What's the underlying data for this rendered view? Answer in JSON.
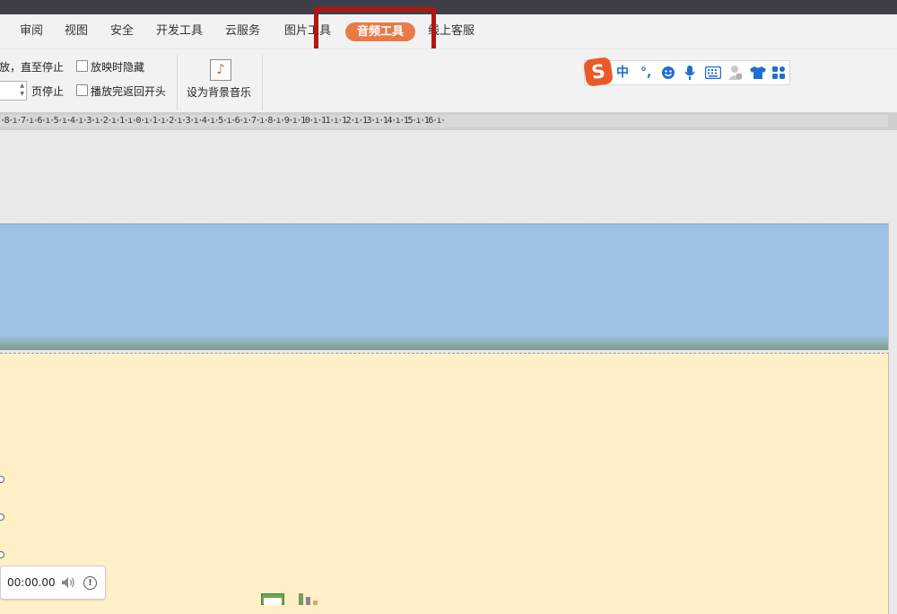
{
  "menu": {
    "tabs": [
      {
        "label": "审阅"
      },
      {
        "label": "视图"
      },
      {
        "label": "安全"
      },
      {
        "label": "开发工具"
      },
      {
        "label": "云服务"
      },
      {
        "label": "图片工具"
      },
      {
        "label": "音频工具",
        "active": true
      },
      {
        "label": "线上客服"
      }
    ]
  },
  "ribbon": {
    "play_until_stop_label": "放，直至停止",
    "page_stop_label": "页停止",
    "hide_when_showing_label": "放映时隐藏",
    "rewind_after_play_label": "播放完返回开头",
    "set_background_music_label": "设为背景音乐"
  },
  "ime_toolbar": {
    "logo": "S",
    "mode": "中",
    "punctuation": "°,"
  },
  "ruler": {
    "text": "·8·ı·7·ı·6·ı·5·ı·4·ı·3·ı·2·ı·1·ı·0·ı·1·ı·2·ı·3·ı·4·ı·5·ı·6·ı·7·ı·8·ı·9·ı·10·ı·11·ı·12·ı·13·ı·14·ı·15·ı·16·ı·"
  },
  "player": {
    "time": "00:00.00",
    "info_symbol": "!"
  },
  "colors": {
    "active_tab": "#e77b47",
    "highlight_box": "#b3160f",
    "slide_sky": "#9dc2e6",
    "slide_sand": "#fff0c8",
    "ime_icons": "#1f6fcf",
    "ime_logo": "#ea5a28"
  }
}
